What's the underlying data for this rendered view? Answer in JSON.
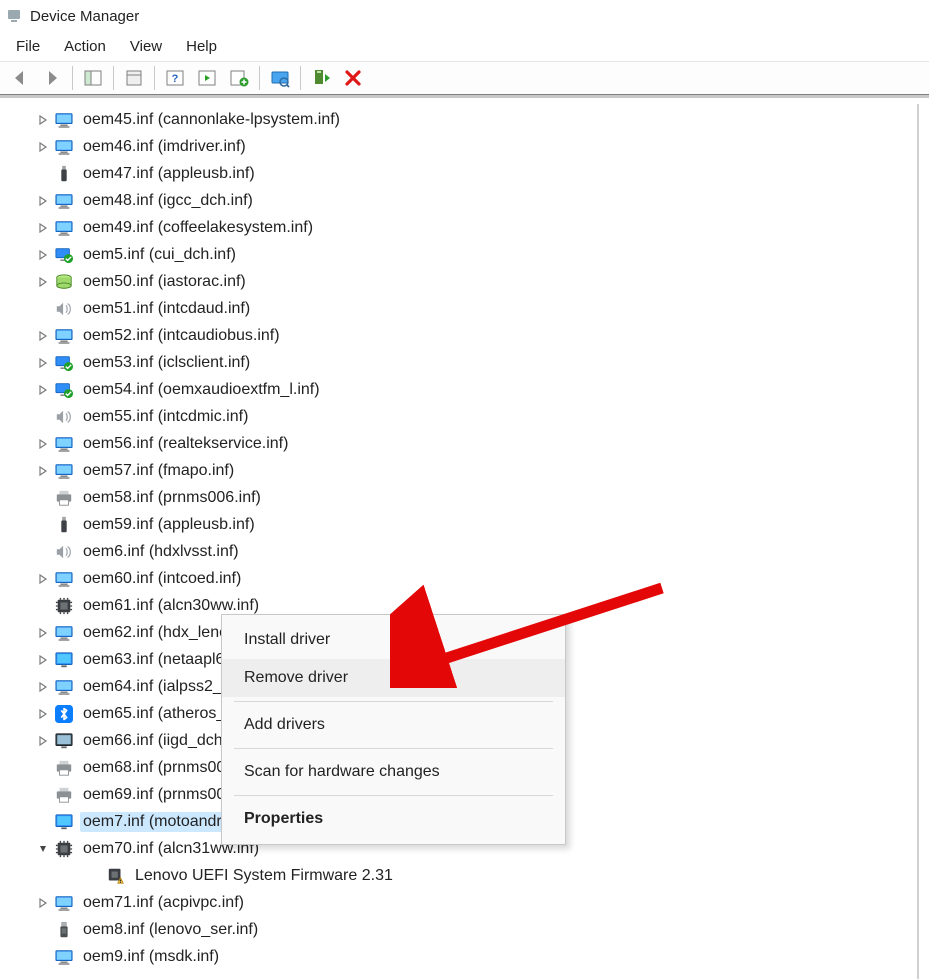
{
  "title": "Device Manager",
  "menu": {
    "file": "File",
    "action": "Action",
    "view": "View",
    "help": "Help"
  },
  "tree": [
    {
      "i": 1,
      "e": ">",
      "ico": "monitor",
      "t": "oem45.inf (cannonlake-lpsystem.inf)"
    },
    {
      "i": 1,
      "e": ">",
      "ico": "monitor",
      "t": "oem46.inf (imdriver.inf)"
    },
    {
      "i": 1,
      "e": "",
      "ico": "usb",
      "t": "oem47.inf (appleusb.inf)"
    },
    {
      "i": 1,
      "e": ">",
      "ico": "monitor",
      "t": "oem48.inf (igcc_dch.inf)"
    },
    {
      "i": 1,
      "e": ">",
      "ico": "monitor",
      "t": "oem49.inf (coffeelakesystem.inf)"
    },
    {
      "i": 1,
      "e": ">",
      "ico": "monitorg",
      "t": "oem5.inf (cui_dch.inf)"
    },
    {
      "i": 1,
      "e": ">",
      "ico": "storage",
      "t": "oem50.inf (iastorac.inf)"
    },
    {
      "i": 1,
      "e": "",
      "ico": "speaker",
      "t": "oem51.inf (intcdaud.inf)"
    },
    {
      "i": 1,
      "e": ">",
      "ico": "monitor",
      "t": "oem52.inf (intcaudiobus.inf)"
    },
    {
      "i": 1,
      "e": ">",
      "ico": "monitorg",
      "t": "oem53.inf (iclsclient.inf)"
    },
    {
      "i": 1,
      "e": ">",
      "ico": "monitorg",
      "t": "oem54.inf (oemxaudioextfm_l.inf)"
    },
    {
      "i": 1,
      "e": "",
      "ico": "speaker",
      "t": "oem55.inf (intcdmic.inf)"
    },
    {
      "i": 1,
      "e": ">",
      "ico": "monitor",
      "t": "oem56.inf (realtekservice.inf)"
    },
    {
      "i": 1,
      "e": ">",
      "ico": "monitor",
      "t": "oem57.inf (fmapo.inf)"
    },
    {
      "i": 1,
      "e": "",
      "ico": "printer",
      "t": "oem58.inf (prnms006.inf)"
    },
    {
      "i": 1,
      "e": "",
      "ico": "usb",
      "t": "oem59.inf (appleusb.inf)"
    },
    {
      "i": 1,
      "e": "",
      "ico": "speaker",
      "t": "oem6.inf (hdxlvsst.inf)"
    },
    {
      "i": 1,
      "e": ">",
      "ico": "monitor",
      "t": "oem60.inf (intcoed.inf)"
    },
    {
      "i": 1,
      "e": "",
      "ico": "chip",
      "t": "oem61.inf (alcn30ww.inf)"
    },
    {
      "i": 1,
      "e": ">",
      "ico": "monitor",
      "t": "oem62.inf (hdx_lenovoext_dolbyaposvc.inf)"
    },
    {
      "i": 1,
      "e": ">",
      "ico": "display",
      "t": "oem63.inf (netaapl64.inf)"
    },
    {
      "i": 1,
      "e": ">",
      "ico": "monitor",
      "t": "oem64.inf (ialpss2_mecc.inf)"
    },
    {
      "i": 1,
      "e": ">",
      "ico": "bt",
      "t": "oem65.inf (atheros_bth.inf)"
    },
    {
      "i": 1,
      "e": ">",
      "ico": "display2",
      "t": "oem66.inf (iigd_dch.inf)"
    },
    {
      "i": 1,
      "e": "",
      "ico": "printer",
      "t": "oem68.inf (prnms009.inf)"
    },
    {
      "i": 1,
      "e": "",
      "ico": "printer",
      "t": "oem69.inf (prnms001.inf)"
    },
    {
      "i": 1,
      "e": "",
      "ico": "display",
      "t": "oem7.inf (motoandroid2.inf)",
      "sel": true
    },
    {
      "i": 1,
      "e": "v",
      "ico": "chip",
      "t": "oem70.inf (alcn31ww.inf)"
    },
    {
      "i": 2,
      "e": "",
      "ico": "chipw",
      "t": "Lenovo UEFI System Firmware 2.31"
    },
    {
      "i": 1,
      "e": ">",
      "ico": "monitor",
      "t": "oem71.inf (acpivpc.inf)"
    },
    {
      "i": 1,
      "e": "",
      "ico": "usb2",
      "t": "oem8.inf (lenovo_ser.inf)"
    },
    {
      "i": 1,
      "e": "",
      "ico": "monitor",
      "t": "oem9.inf (msdk.inf)"
    }
  ],
  "ctx": {
    "install": "Install driver",
    "remove": "Remove driver",
    "add": "Add drivers",
    "scan": "Scan for hardware changes",
    "props": "Properties"
  }
}
